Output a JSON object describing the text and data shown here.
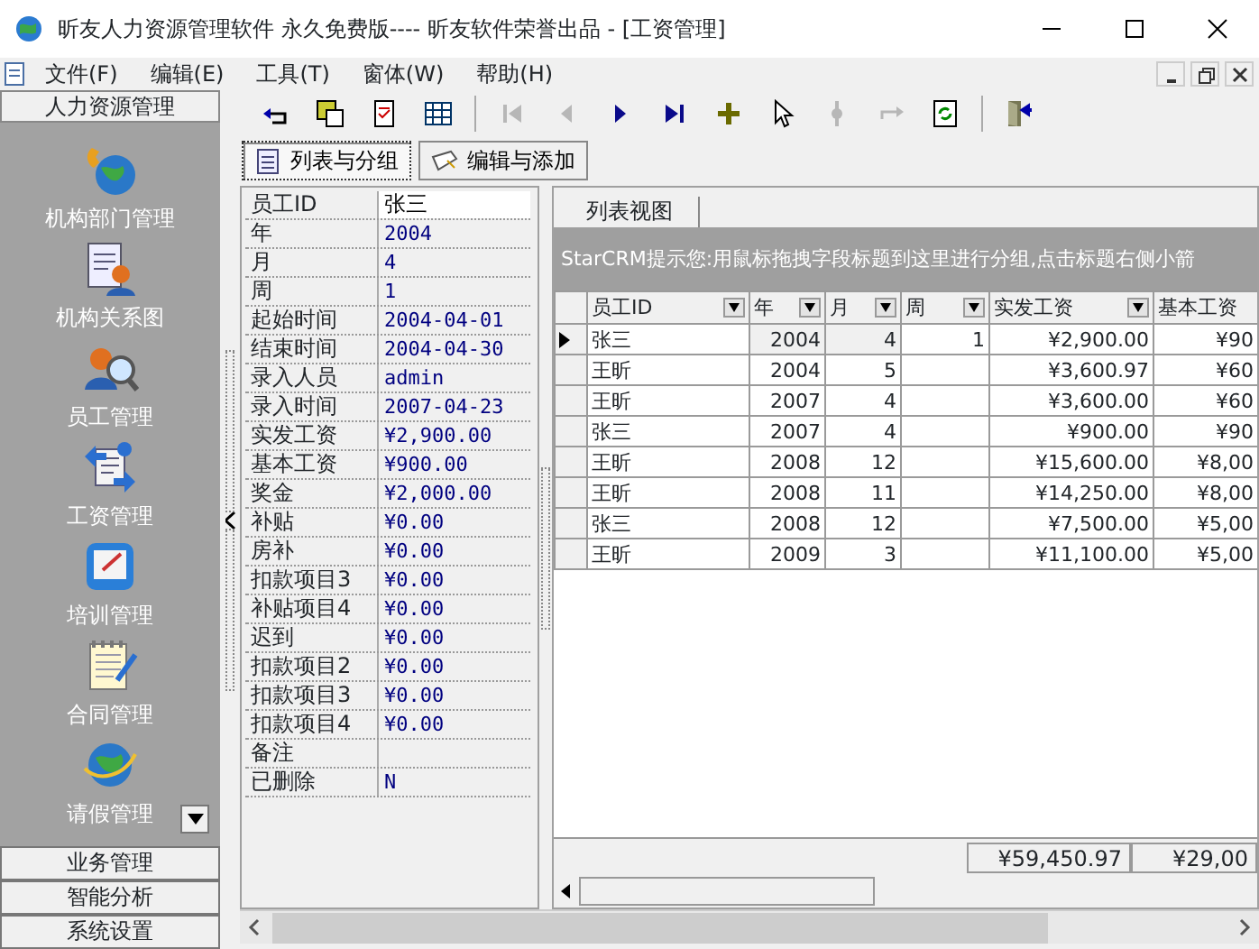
{
  "window": {
    "title": "昕友人力资源管理软件 永久免费版---- 昕友软件荣誉出品  - [工资管理]"
  },
  "menu": [
    "文件(F)",
    "编辑(E)",
    "工具(T)",
    "窗体(W)",
    "帮助(H)"
  ],
  "sidebar": {
    "header": "人力资源管理",
    "items": [
      {
        "label": "机构部门管理"
      },
      {
        "label": "机构关系图"
      },
      {
        "label": "员工管理"
      },
      {
        "label": "工资管理"
      },
      {
        "label": "培训管理"
      },
      {
        "label": "合同管理"
      },
      {
        "label": "请假管理"
      }
    ],
    "sections": [
      "业务管理",
      "智能分析",
      "系统设置"
    ]
  },
  "toolbar": [
    {
      "disabled": false
    },
    {
      "disabled": false
    },
    {
      "disabled": false
    },
    {
      "disabled": false
    },
    {
      "disabled": true
    },
    {
      "disabled": true
    },
    {
      "disabled": false
    },
    {
      "disabled": false
    },
    {
      "disabled": false
    },
    {
      "disabled": false
    },
    {
      "disabled": true
    },
    {
      "disabled": true
    },
    {
      "disabled": false
    },
    {
      "disabled": false
    }
  ],
  "view_buttons": [
    {
      "label": "列表与分组",
      "selected": true
    },
    {
      "label": "编辑与添加",
      "selected": false
    }
  ],
  "properties": [
    {
      "label": "员工ID",
      "value": "张三",
      "selected": true
    },
    {
      "label": "年",
      "value": "2004",
      "selected": false
    },
    {
      "label": "月",
      "value": "4",
      "selected": false
    },
    {
      "label": "周",
      "value": "1",
      "selected": false
    },
    {
      "label": "起始时间",
      "value": "2004-04-01",
      "selected": false
    },
    {
      "label": "结束时间",
      "value": "2004-04-30",
      "selected": false
    },
    {
      "label": "录入人员",
      "value": "admin",
      "selected": false
    },
    {
      "label": "录入时间",
      "value": "2007-04-23",
      "selected": false
    },
    {
      "label": "实发工资",
      "value": "¥2,900.00",
      "selected": false
    },
    {
      "label": "基本工资",
      "value": "¥900.00",
      "selected": false
    },
    {
      "label": "奖金",
      "value": "¥2,000.00",
      "selected": false
    },
    {
      "label": "补贴",
      "value": "¥0.00",
      "selected": false
    },
    {
      "label": "房补",
      "value": "¥0.00",
      "selected": false
    },
    {
      "label": "扣款项目3",
      "value": "¥0.00",
      "selected": false
    },
    {
      "label": "补贴项目4",
      "value": "¥0.00",
      "selected": false
    },
    {
      "label": "迟到",
      "value": "¥0.00",
      "selected": false
    },
    {
      "label": "扣款项目2",
      "value": "¥0.00",
      "selected": false
    },
    {
      "label": "扣款项目3",
      "value": "¥0.00",
      "selected": false
    },
    {
      "label": "扣款项目4",
      "value": "¥0.00",
      "selected": false
    },
    {
      "label": "备注",
      "selected": false
    },
    {
      "label": "已删除",
      "value": "N",
      "selected": false
    }
  ],
  "grid": {
    "tab": "列表视图",
    "hint": "StarCRM提示您:用鼠标拖拽字段标题到这里进行分组,点击标题右侧小箭",
    "columns": [
      {
        "label": "员工ID",
        "dropdown": true
      },
      {
        "label": "年",
        "dropdown": true
      },
      {
        "label": "月",
        "dropdown": true
      },
      {
        "label": "周",
        "dropdown": true
      },
      {
        "label": "实发工资",
        "dropdown": true
      },
      {
        "label": "基本工资",
        "dropdown": false
      }
    ],
    "rows": [
      {
        "selected": true,
        "cells": [
          "张三",
          "2004",
          "4",
          "1",
          "¥2,900.00",
          "¥90"
        ]
      },
      {
        "selected": false,
        "cells": [
          "王昕",
          "2004",
          "5",
          "",
          "¥3,600.97",
          "¥60"
        ]
      },
      {
        "selected": false,
        "cells": [
          "王昕",
          "2007",
          "4",
          "",
          "¥3,600.00",
          "¥60"
        ]
      },
      {
        "selected": false,
        "cells": [
          "张三",
          "2007",
          "4",
          "",
          "¥900.00",
          "¥90"
        ]
      },
      {
        "selected": false,
        "cells": [
          "王昕",
          "2008",
          "12",
          "",
          "¥15,600.00",
          "¥8,00"
        ]
      },
      {
        "selected": false,
        "cells": [
          "王昕",
          "2008",
          "11",
          "",
          "¥14,250.00",
          "¥8,00"
        ]
      },
      {
        "selected": false,
        "cells": [
          "张三",
          "2008",
          "12",
          "",
          "¥7,500.00",
          "¥5,00"
        ]
      },
      {
        "selected": false,
        "cells": [
          "王昕",
          "2009",
          "3",
          "",
          "¥11,100.00",
          "¥5,00"
        ]
      }
    ],
    "totals": [
      "¥59,450.97",
      "¥29,00"
    ]
  }
}
